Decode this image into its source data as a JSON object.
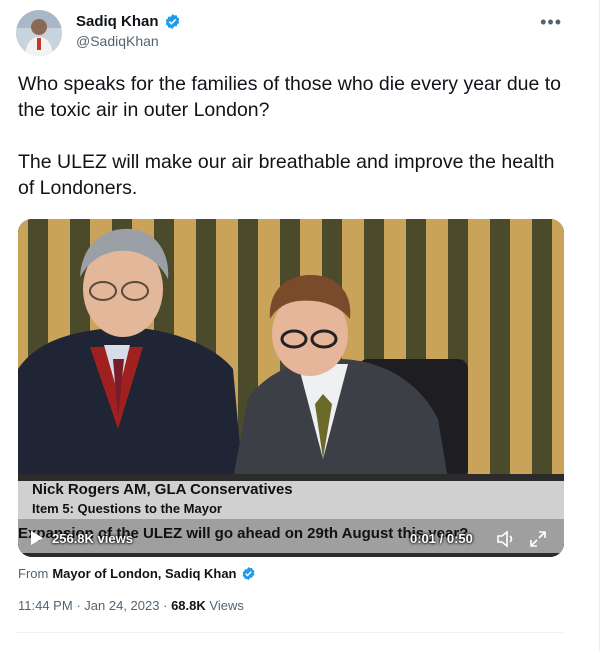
{
  "author": {
    "name": "Sadiq Khan",
    "handle": "@SadiqKhan"
  },
  "more_label": "•••",
  "tweet": {
    "paragraph1": "Who speaks for the families of those who die every year due to the toxic air in outer London?",
    "paragraph2": "The ULEZ will make our air breathable and improve the health of Londoners."
  },
  "video": {
    "caption_name": "Nick Rogers AM, GLA Conservatives",
    "caption_item": "Item 5: Questions to the Mayor",
    "caption_question": "Expansion of the ULEZ will go ahead on 29th August this year?",
    "views": "256.8K views",
    "time": "0:01 / 0:50"
  },
  "source": {
    "prefix": "From",
    "name": "Mayor of London, Sadiq Khan"
  },
  "meta": {
    "time": "11:44 PM",
    "sep1": "·",
    "date": "Jan 24, 2023",
    "sep2": "·",
    "views_count": "68.8K",
    "views_label": "Views"
  },
  "colors": {
    "verified_badge": "#1d9bf0",
    "secondary_text": "#536471"
  }
}
